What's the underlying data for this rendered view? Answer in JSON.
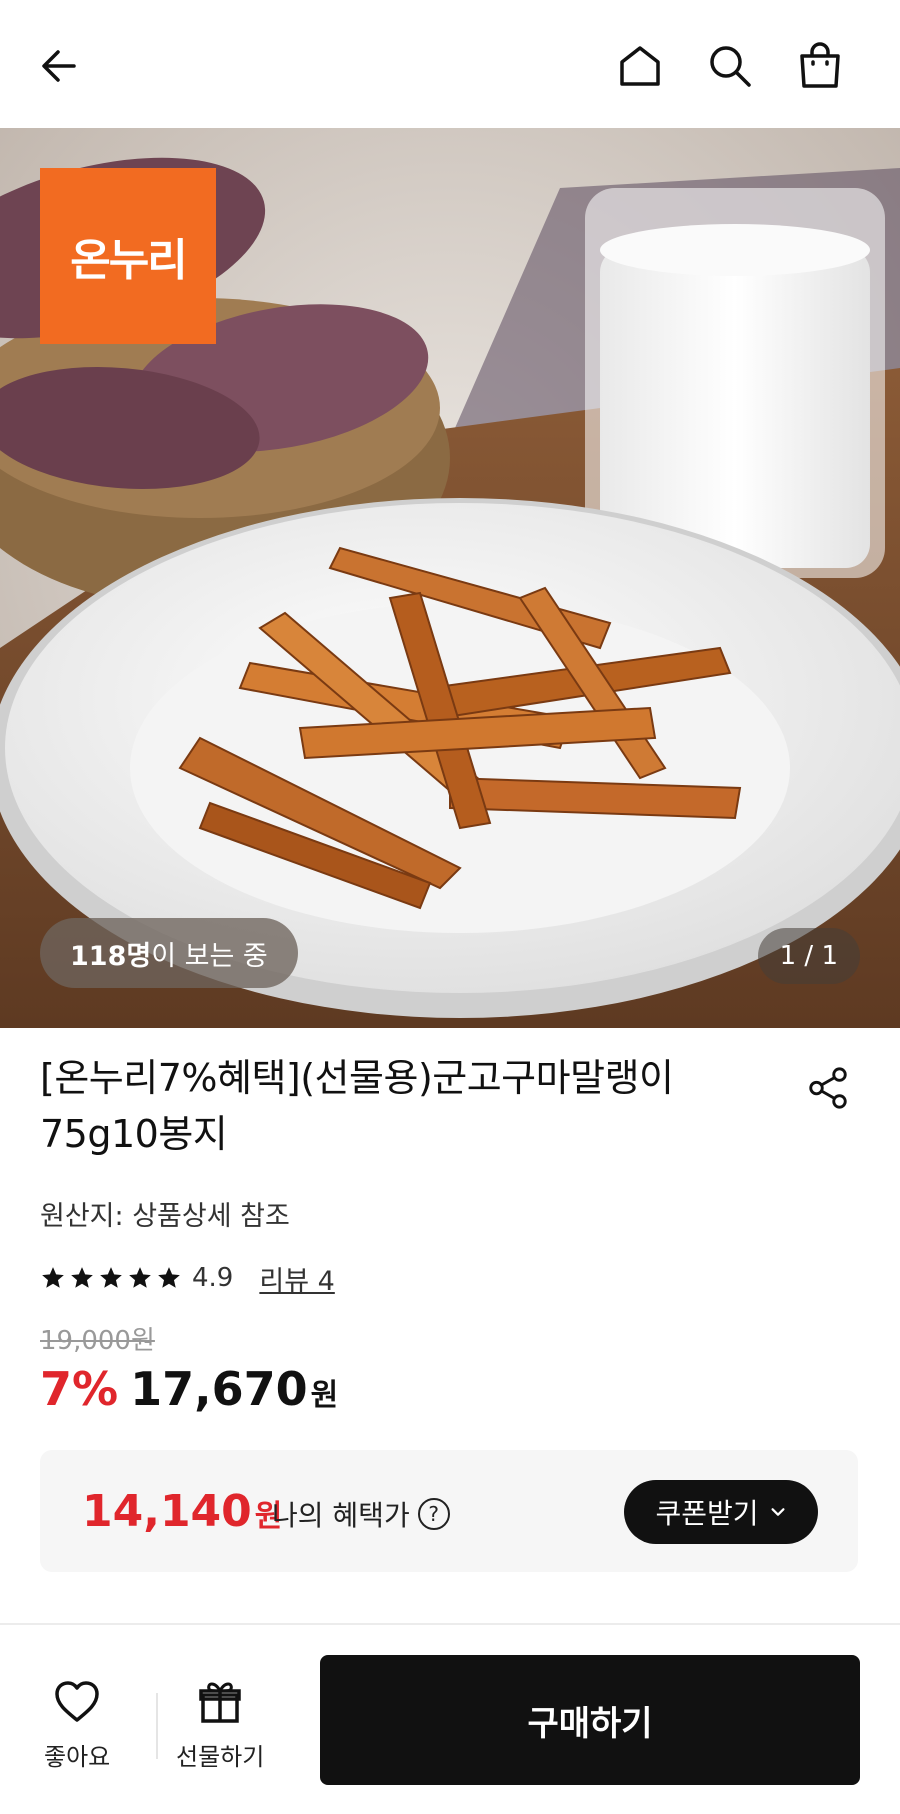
{
  "hero": {
    "brand_badge": "온누리",
    "viewers_count": "118명",
    "viewers_suffix": "이 보는 중",
    "pager": "1 / 1"
  },
  "product": {
    "title": "[온누리7%혜택](선물용)군고구마말랭이 75g10봉지",
    "origin": "원산지: 상품상세 참조",
    "rating": "4.9",
    "stars": 5,
    "review_link": "리뷰 4",
    "original_price": "19,000원",
    "discount": "7%",
    "price": "17,670",
    "price_unit": "원"
  },
  "benefit": {
    "price": "14,140",
    "price_unit": "원",
    "label": "나의 혜택가",
    "help_icon": "?",
    "coupon_button": "쿠폰받기"
  },
  "bottom_bar": {
    "like_label": "좋아요",
    "gift_label": "선물하기",
    "buy_label": "구매하기"
  },
  "colors": {
    "accent_red": "#e0262c",
    "brand_orange": "#f26b21",
    "dark": "#111111"
  },
  "icons": {
    "back": "arrow-left-icon",
    "home": "home-icon",
    "search": "search-icon",
    "cart": "shopping-bag-icon",
    "share": "share-icon",
    "star": "star-icon",
    "like": "heart-icon",
    "gift": "gift-icon",
    "coupon_chevron": "chevron-down-icon"
  }
}
